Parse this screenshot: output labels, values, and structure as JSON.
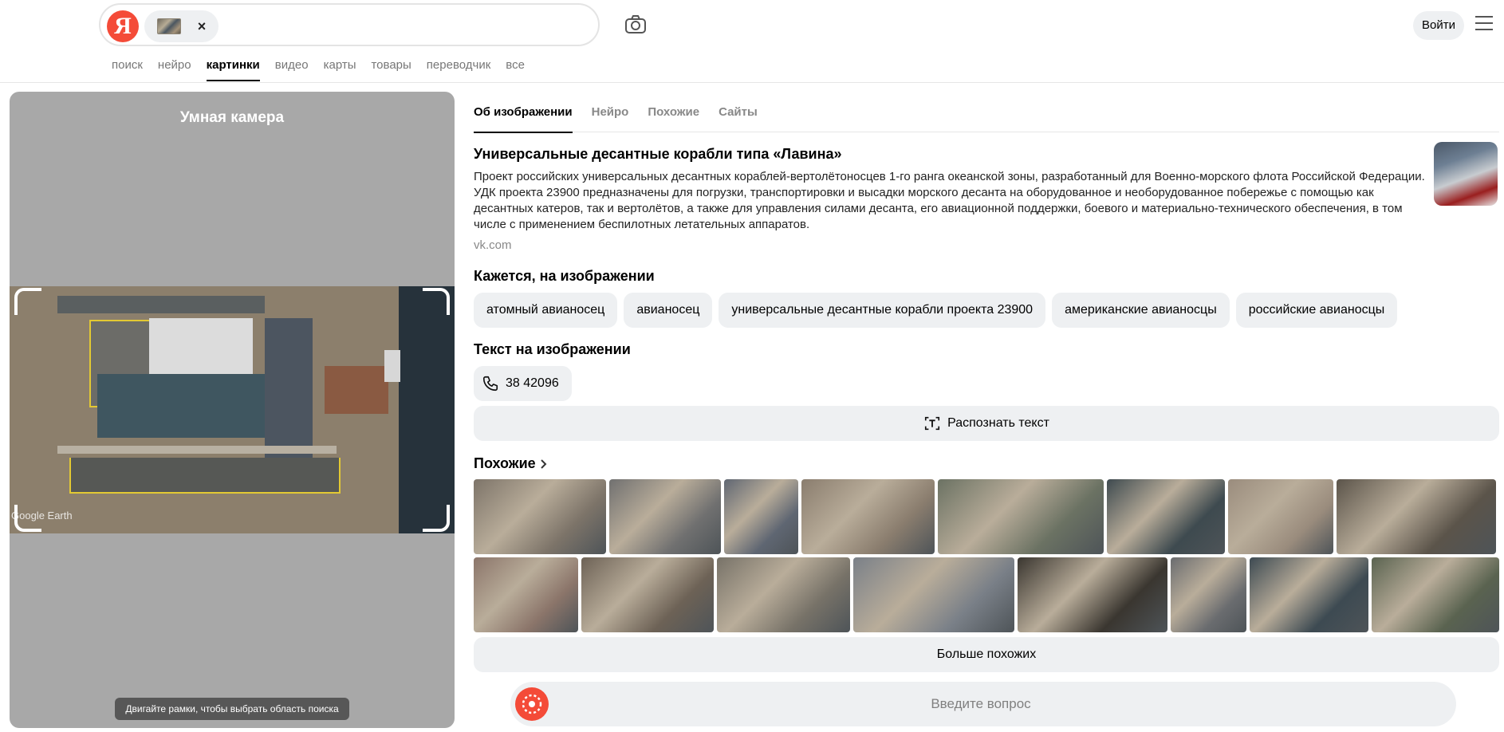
{
  "header": {
    "logo": "Я",
    "close_label": "×",
    "login_label": "Войти",
    "nav": [
      "поиск",
      "нейро",
      "картинки",
      "видео",
      "карты",
      "товары",
      "переводчик",
      "все"
    ],
    "nav_active": "картинки"
  },
  "left": {
    "title": "Умная камера",
    "watermark": "Google Earth",
    "hint": "Двигайте рамки, чтобы выбрать область поиска"
  },
  "tabs": [
    "Об изображении",
    "Нейро",
    "Похожие",
    "Сайты"
  ],
  "entity": {
    "title": "Универсальные десантные корабли типа «Лавина»",
    "description": "Проект российских универсальных десантных кораблей-вертолётоносцев 1-го ранга океанской зоны, разработанный для Военно-морского флота Российской Федерации. УДК проекта 23900 предназначены для погрузки, транспортировки и высадки морского десанта на оборудованное и необорудованное побережье с помощью как десантных катеров, так и вертолётов, а также для управления силами десанта, его авиационной поддержки, боевого и материально-технического обеспечения, в том числе с применением беспилотных летательных аппаратов.",
    "source": "vk.com"
  },
  "seems": {
    "title": "Кажется, на изображении",
    "tags": [
      "атомный авианосец",
      "авианосец",
      "универсальные десантные корабли проекта 23900",
      "американские авианосцы",
      "российские авианосцы"
    ]
  },
  "text_on_image": {
    "title": "Текст на изображении",
    "phone": "38 42096",
    "recognize_label": "Распознать текст"
  },
  "similar": {
    "title": "Похожие",
    "more_label": "Больше похожих",
    "colors": [
      "#7d7469",
      "#707070",
      "#5f6672",
      "#8a7d6e",
      "#6b7263",
      "#3e4a4f",
      "#9a8c7d",
      "#5b544a",
      "#8b756a",
      "#6d6256",
      "#777268",
      "#7a8088",
      "#3a3630",
      "#6a6c6f",
      "#3d4a52",
      "#5a6350"
    ]
  },
  "ask": {
    "placeholder": "Введите вопрос"
  }
}
